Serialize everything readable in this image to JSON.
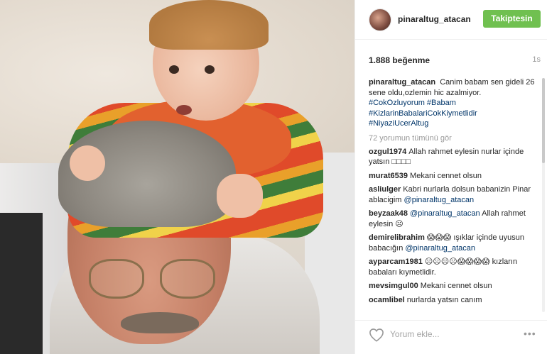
{
  "post": {
    "photo_alt": "Photo"
  },
  "header": {
    "username": "pinaraltug_atacan",
    "follow_label": "Takiptesin"
  },
  "stats": {
    "likes": "1.888 beğenme",
    "time": "1s"
  },
  "caption": {
    "user": "pinaraltug_atacan",
    "text": "Canim babam sen gideli 26 sene oldu,ozlemin hic azalmiyor.",
    "tags": "#CokOzluyorum #Babam #KizlarinBabalariCokKiymetlidir #NiyaziUcerAltug"
  },
  "view_all": "72 yorumun tümünü gör",
  "comments": [
    {
      "user": "ozgul1974",
      "text": "Allah rahmet eylesin nurlar içinde yatsın □□□□",
      "mention": ""
    },
    {
      "user": "murat6539",
      "text": "Mekani cennet olsun",
      "mention": ""
    },
    {
      "user": "asliulger",
      "text": "Kabri nurlarla dolsun babanizin Pinar ablacigim",
      "mention": "@pinaraltug_atacan"
    },
    {
      "user": "beyzaak48",
      "text": "Allah rahmet eylesin ☹",
      "mention": "@pinaraltug_atacan"
    },
    {
      "user": "demirelibrahim",
      "text": "😱😱😱 ışıklar içinde uyusun babacığın",
      "mention": "@pinaraltug_atacan"
    },
    {
      "user": "ayparcam1981",
      "text": "☹☹☹☹😱😱😱😱 kızların babaları kıymetlidir.",
      "mention": ""
    },
    {
      "user": "mevsimgul00",
      "text": "Mekani cennet olsun",
      "mention": ""
    },
    {
      "user": "ocamlibel",
      "text": "nurlarda yatsın canım",
      "mention": ""
    }
  ],
  "footer": {
    "comment_placeholder": "Yorum ekle...",
    "more_label": "•••"
  },
  "colors": {
    "follow_button": "#70c050",
    "mention": "#003569"
  }
}
